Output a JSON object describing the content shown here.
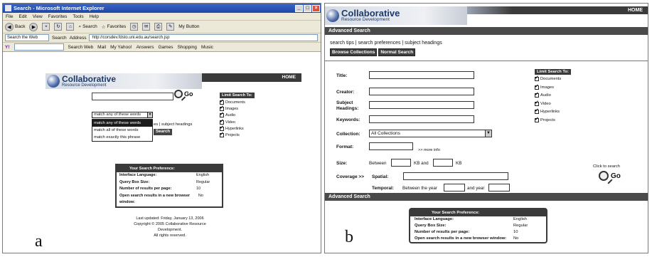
{
  "panel_a": {
    "label": "a",
    "window": {
      "title": "Search - Microsoft Internet Explorer",
      "menu": [
        "File",
        "Edit",
        "View",
        "Favorites",
        "Tools",
        "Help"
      ],
      "toolbar": {
        "back": "Back",
        "search": "Search",
        "favorites": "Favorites",
        "my_button": "My Button"
      },
      "address": {
        "label": "Address",
        "url": "http://corsdev.fdsto.uni.edu.au/search.jsp",
        "search_web": "Search the Web",
        "search_btn": "Search",
        "yahoo": "Y!"
      },
      "links": [
        "Search Web",
        "Mail",
        "My Yahoo!",
        "Answers",
        "Games",
        "Shopping",
        "Music"
      ]
    },
    "header": {
      "brand": "Collaborative",
      "sub": "Resource Development",
      "home": "HOME"
    },
    "go": "Go",
    "limit": {
      "title": "Limit Search To:",
      "items": [
        "Documents",
        "Images",
        "Audio",
        "Video",
        "Hyperlinks",
        "Projects"
      ]
    },
    "match": {
      "selected": "match any of these words",
      "options": [
        "match any of these words",
        "match all of these words",
        "match exactly this phrase"
      ],
      "behind_links": "es | subject headings",
      "behind_button": "Search"
    },
    "preferences": {
      "title": "Your Search Preference:",
      "rows": [
        {
          "k": "Interface Language:",
          "v": "English"
        },
        {
          "k": "Query Box Size:",
          "v": "Regular"
        },
        {
          "k": "Number of results per page:",
          "v": "10"
        },
        {
          "k": "Open search results in a new browser window:",
          "v": "No"
        }
      ]
    },
    "footer": {
      "updated": "Last updated: Friday, January 13, 2006",
      "copyright": "Copyright © 2005 Collaborative Resource Development.",
      "rights": "All rights reserved."
    }
  },
  "panel_b": {
    "label": "b",
    "header": {
      "brand": "Collaborative",
      "sub": "Resource Development",
      "home": "HOME"
    },
    "section_title": "Advanced Search",
    "links": "search tips | search preferences | subject headings",
    "tabs": [
      "Browse Collections",
      "Normal Search"
    ],
    "fields": {
      "title": "Title:",
      "creator": "Creator:",
      "subject": "Subject",
      "headings": "Headings:",
      "keywords": "Keywords:",
      "collection": "Collection:",
      "collection_value": "All Collections",
      "format": "Format:",
      "more_info": ">> more info",
      "size": "Size:",
      "between": "Between",
      "kb_and": "KB and",
      "kb": "KB",
      "coverage": "Coverage >>",
      "spatial": "Spatial:",
      "temporal": "Temporal:",
      "between_year": "Between the year",
      "and_year": "and year"
    },
    "limit": {
      "title": "Limit Search To:",
      "items": [
        "Documents",
        "Images",
        "Audio",
        "Video",
        "Hyperlinks",
        "Projects"
      ]
    },
    "click_to_search": "Click to search",
    "go": "Go",
    "preferences": {
      "title": "Your Search Preference:",
      "rows": [
        {
          "k": "Interface Language:",
          "v": "English"
        },
        {
          "k": "Query Box Size:",
          "v": "Regular"
        },
        {
          "k": "Number of results per page:",
          "v": "10"
        },
        {
          "k": "Open search results in a new browser window:",
          "v": "No"
        }
      ]
    }
  }
}
